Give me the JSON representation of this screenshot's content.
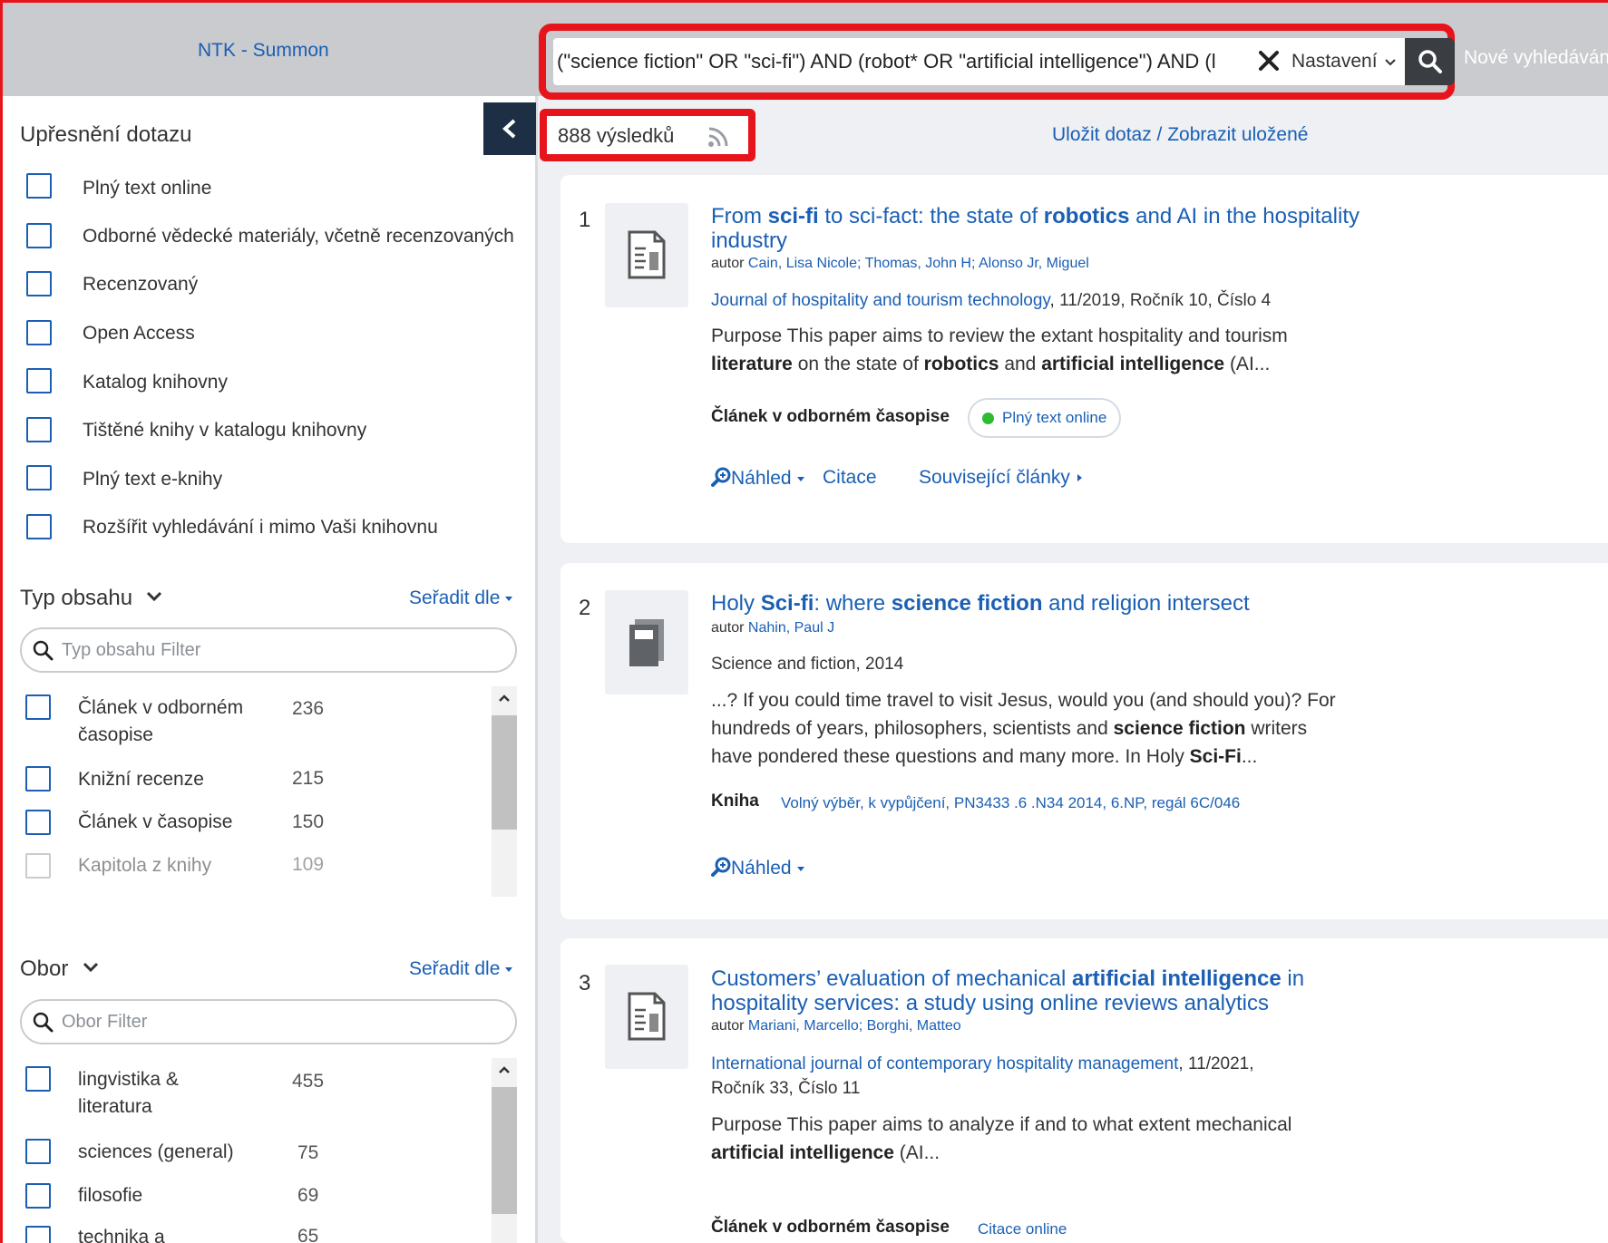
{
  "header": {
    "brand": "NTK - Summon",
    "search_value": "(\"science fiction\" OR \"sci-fi\") AND (robot* OR \"artificial intelligence\") AND (l",
    "settings_label": "Nastavení",
    "new_search": "Nové vyhledávání"
  },
  "sidebar": {
    "refine_title": "Upřesnění dotazu",
    "options": [
      "Plný text online",
      "Odborné vědecké materiály, včetně recenzovaných",
      "Recenzovaný",
      "Open Access",
      "Katalog knihovny",
      "Tištěné knihy v katalogu knihovny",
      "Plný text e-knihy",
      "Rozšířit vyhledávání i mimo Vaši knihovnu"
    ],
    "content_type": {
      "title": "Typ obsahu",
      "sort_label": "Seřadit dle",
      "filter_placeholder": "Typ obsahu Filter",
      "items": [
        {
          "label": "Článek v odborném časopise",
          "count": "236"
        },
        {
          "label": "Knižní recenze",
          "count": "215"
        },
        {
          "label": "Článek v časopise",
          "count": "150"
        },
        {
          "label": "Kapitola z knihy",
          "count": "109"
        }
      ]
    },
    "subject": {
      "title": "Obor",
      "sort_label": "Seřadit dle",
      "filter_placeholder": "Obor Filter",
      "items": [
        {
          "label": "lingvistika & literatura",
          "count": "455"
        },
        {
          "label": "sciences (general)",
          "count": "75"
        },
        {
          "label": "filosofie",
          "count": "69"
        },
        {
          "label": "technika a",
          "count": "65"
        }
      ]
    }
  },
  "main": {
    "results_count": "888 výsledků",
    "save_query": "Uložit dotaz / Zobrazit uložené",
    "results": [
      {
        "rank": "1",
        "author_prefix": "autor",
        "authors": "Cain, Lisa Nicole; Thomas, John H; Alonso Jr, Miguel",
        "source_link": "Journal of hospitality and tourism technology",
        "source_rest": ", 11/2019, Ročník 10, Číslo 4",
        "type": "Článek v odborném časopise",
        "availability": "Plný text online",
        "actions": [
          "Náhled",
          "Citace",
          "Související články"
        ]
      },
      {
        "rank": "2",
        "author_prefix": "autor",
        "authors": "Nahin, Paul J",
        "source": "Science and fiction, 2014",
        "type": "Kniha",
        "availability": "Volný výběr, k vypůjčení, PN3433 .6 .N34 2014, 6.NP, regál 6C/046",
        "actions": [
          "Náhled"
        ]
      },
      {
        "rank": "3",
        "author_prefix": "autor",
        "authors": "Mariani, Marcello; Borghi, Matteo",
        "source_link": "International journal of contemporary hospitality management",
        "source_rest": ", 11/2021,",
        "source_line2": "Ročník 33, Číslo 11",
        "type": "Článek v odborném časopise",
        "availability": "Citace online"
      }
    ]
  },
  "colors": {
    "highlight_red": "#e8141c",
    "link_blue": "#1a5fb4",
    "header_gray": "#c9cbce",
    "dark_button": "#3a3d42",
    "collapse_navy": "#1d2f44",
    "online_green": "#2dbb33"
  },
  "icons": [
    "clear-icon",
    "chevron-down-icon",
    "search-icon",
    "chevron-left-icon",
    "rss-icon",
    "article-icon",
    "book-icon",
    "preview-icon",
    "scroll-up-icon"
  ]
}
